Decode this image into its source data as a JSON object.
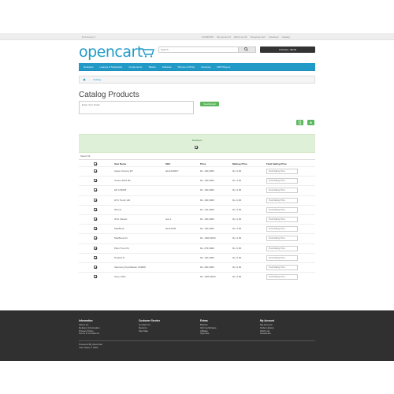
{
  "topbar": {
    "currency": "$ Currency ▾",
    "links": [
      {
        "icon": "phone-icon",
        "label": "123456789"
      },
      {
        "icon": "user-icon",
        "label": "My Account ▾"
      },
      {
        "icon": "heart-icon",
        "label": "Wish List (0)"
      },
      {
        "icon": "cart-icon",
        "label": "Shopping Cart"
      },
      {
        "icon": "share-icon",
        "label": "Checkout"
      },
      {
        "icon": "catalog-icon",
        "label": "Catalog"
      }
    ]
  },
  "header": {
    "logo": "opencart",
    "search_placeholder": "Search",
    "cart_button": "0 item(s) - $0.00"
  },
  "menu": [
    "Desktops",
    "Laptops & Notebooks",
    "Components",
    "Tablets",
    "Software",
    "Phones & PDAs",
    "Cameras",
    "MP3 Players"
  ],
  "breadcrumb": {
    "home_icon": "home-icon",
    "current": "Catalog"
  },
  "page": {
    "title": "Catalog Products",
    "email_placeholder": "Enter Your Email",
    "send_button": "Send Email"
  },
  "banner": {
    "category": "Desktops"
  },
  "select_all": "Select All",
  "table": {
    "headers": [
      "Item Name",
      "SKU",
      "Price",
      "Markup Price",
      "Final Selling Price"
    ],
    "final_placeholder": "Final Selling Price",
    "rows": [
      {
        "name": "Apple Cinema 30\"",
        "sku": "abc1234567",
        "price": "Rs. 100,0000",
        "markup": "Rs. 0.00"
      },
      {
        "name": "Canon EOS 5D",
        "sku": "",
        "price": "Rs. 100,0000",
        "markup": "Rs. 0.00"
      },
      {
        "name": "HP LP3065",
        "sku": "",
        "price": "Rs. 100,0000",
        "markup": "Rs. 0.00"
      },
      {
        "name": "HTC Touch HD",
        "sku": "",
        "price": "Rs. 100,0000",
        "markup": "Rs. 0.00"
      },
      {
        "name": "iPhone",
        "sku": "",
        "price": "Rs. 101,0000",
        "markup": "Rs. 0.00"
      },
      {
        "name": "iPod Classic",
        "sku": "test 1",
        "price": "Rs. 100,0000",
        "markup": "Rs. 0.00"
      },
      {
        "name": "MacBook",
        "sku": "abc12345",
        "price": "Rs. 100,0000",
        "markup": "Rs. 0.00"
      },
      {
        "name": "MacBook Air",
        "sku": "",
        "price": "Rs. 1000,0000",
        "markup": "Rs. 0.00"
      },
      {
        "name": "Palm Treo Pro",
        "sku": "",
        "price": "Rs. 279,9900",
        "markup": "Rs. 0.00"
      },
      {
        "name": "Product 8",
        "sku": "",
        "price": "Rs. 100,0000",
        "markup": "Rs. 0.00"
      },
      {
        "name": "Samsung SyncMaster 941BW",
        "sku": "",
        "price": "Rs. 200,0000",
        "markup": "Rs. 0.00"
      },
      {
        "name": "Sony VAIO",
        "sku": "",
        "price": "Rs. 1000,0000",
        "markup": "Rs. 0.00"
      }
    ]
  },
  "footer": {
    "columns": [
      {
        "title": "Information",
        "items": [
          "About Us",
          "Delivery Information",
          "Privacy Policy",
          "Terms & Conditions"
        ]
      },
      {
        "title": "Customer Service",
        "items": [
          "Contact Us",
          "Returns",
          "Site Map"
        ]
      },
      {
        "title": "Extras",
        "items": [
          "Brands",
          "Gift Certificates",
          "Affiliate",
          "Specials"
        ]
      },
      {
        "title": "My Account",
        "items": [
          "My Account",
          "Order History",
          "Wish List",
          "Newsletter"
        ]
      }
    ],
    "powered": [
      "Powered By OpenCart",
      "Your Store © 2021"
    ]
  },
  "colors": {
    "brand": "#229ac8",
    "success": "#5cb85c",
    "footer": "#303030"
  }
}
